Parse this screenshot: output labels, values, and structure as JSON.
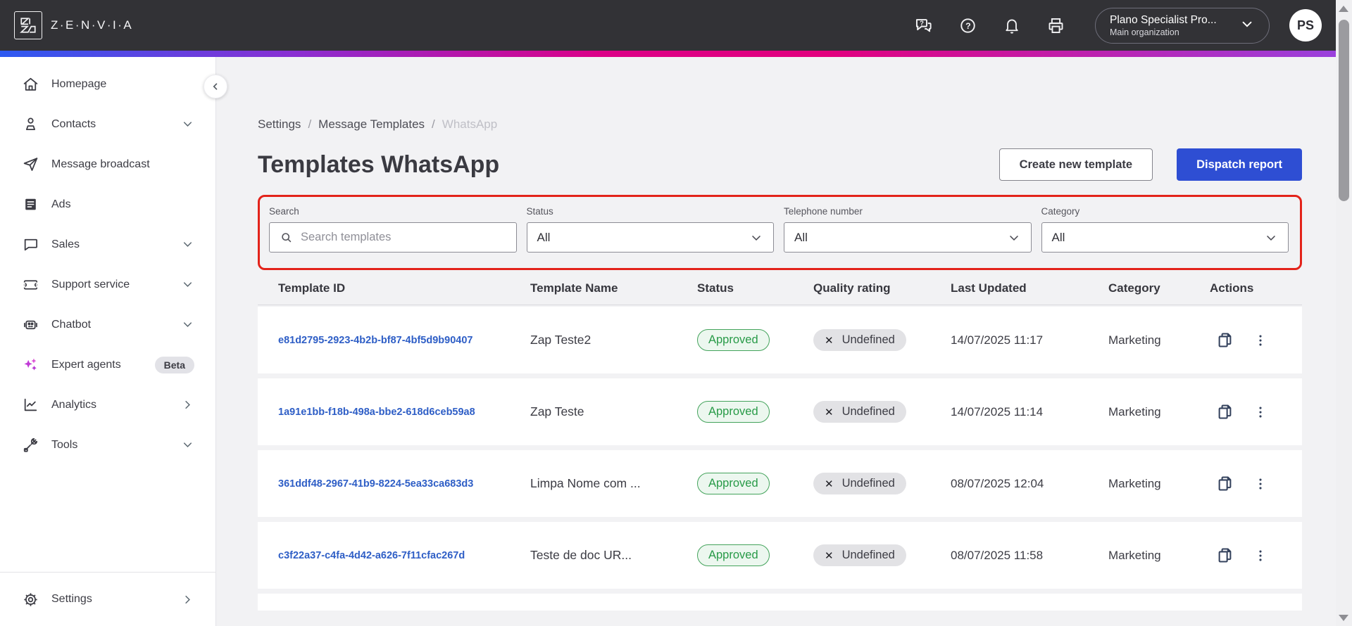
{
  "topbar": {
    "brand": "Z·E·N·V·I·A",
    "org": {
      "name": "Plano Specialist Pro...",
      "sub": "Main organization"
    },
    "avatar_initials": "PS"
  },
  "sidebar": {
    "items": [
      {
        "label": "Homepage",
        "icon": "home-icon",
        "chevron": ""
      },
      {
        "label": "Contacts",
        "icon": "contacts-icon",
        "chevron": "down"
      },
      {
        "label": "Message broadcast",
        "icon": "paper-plane-icon",
        "chevron": ""
      },
      {
        "label": "Ads",
        "icon": "ads-icon",
        "chevron": ""
      },
      {
        "label": "Sales",
        "icon": "sales-icon",
        "chevron": "down"
      },
      {
        "label": "Support service",
        "icon": "ticket-icon",
        "chevron": "down"
      },
      {
        "label": "Chatbot",
        "icon": "robot-icon",
        "chevron": "down"
      },
      {
        "label": "Expert agents",
        "icon": "sparkles-icon",
        "chevron": "",
        "badge": "Beta"
      },
      {
        "label": "Analytics",
        "icon": "analytics-icon",
        "chevron": "right"
      },
      {
        "label": "Tools",
        "icon": "tools-icon",
        "chevron": "down"
      }
    ],
    "footer": {
      "label": "Settings",
      "icon": "gear-icon",
      "chevron": "right"
    }
  },
  "breadcrumb": {
    "items": [
      "Settings",
      "Message Templates",
      "WhatsApp"
    ],
    "separator": "/"
  },
  "page": {
    "title": "Templates WhatsApp"
  },
  "actions": {
    "create": "Create new template",
    "dispatch": "Dispatch report"
  },
  "filters": {
    "search": {
      "label": "Search",
      "placeholder": "Search templates",
      "value": ""
    },
    "status": {
      "label": "Status",
      "value": "All"
    },
    "phone": {
      "label": "Telephone number",
      "value": "All"
    },
    "category": {
      "label": "Category",
      "value": "All"
    }
  },
  "table": {
    "columns": [
      "Template ID",
      "Template Name",
      "Status",
      "Quality rating",
      "Last Updated",
      "Category",
      "Actions"
    ],
    "rows": [
      {
        "id": "e81d2795-2923-4b2b-bf87-4bf5d9b90407",
        "name": "Zap Teste2",
        "status": "Approved",
        "quality": "Undefined",
        "updated": "14/07/2025 11:17",
        "category": "Marketing"
      },
      {
        "id": "1a91e1bb-f18b-498a-bbe2-618d6ceb59a8",
        "name": "Zap Teste",
        "status": "Approved",
        "quality": "Undefined",
        "updated": "14/07/2025 11:14",
        "category": "Marketing"
      },
      {
        "id": "361ddf48-2967-41b9-8224-5ea33ca683d3",
        "name": "Limpa Nome com ...",
        "status": "Approved",
        "quality": "Undefined",
        "updated": "08/07/2025 12:04",
        "category": "Marketing"
      },
      {
        "id": "c3f22a37-c4fa-4d42-a626-7f11cfac267d",
        "name": "Teste de doc UR...",
        "status": "Approved",
        "quality": "Undefined",
        "updated": "08/07/2025 11:58",
        "category": "Marketing"
      }
    ]
  },
  "colors": {
    "topbar_bg": "#323236",
    "gradient": [
      "#2d5af1",
      "#8a2fd2",
      "#e2007e",
      "#9a41dc"
    ],
    "primary_button": "#2e4ed3",
    "link_blue": "#2e5ec6",
    "approved_green": "#279a47",
    "approved_bg": "#ecf7ef",
    "quality_pill_bg": "#e2e2e5",
    "annotation_red": "#e3231a",
    "content_bg": "#f2f2f4"
  }
}
